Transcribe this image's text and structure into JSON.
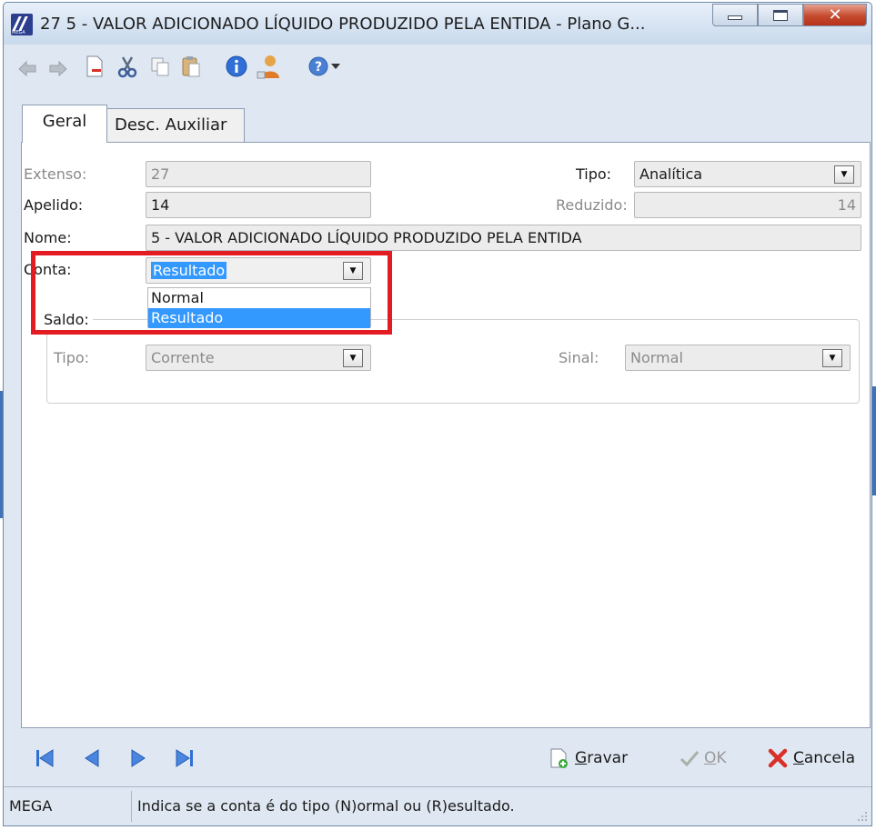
{
  "window": {
    "title": "27 5 - VALOR ADICIONADO LÍQUIDO PRODUZIDO PELA ENTIDA - Plano G...",
    "app_icon_text": "MEGA"
  },
  "toolbar": {
    "icons": [
      "back-icon",
      "forward-icon",
      "new-document-icon",
      "cut-icon",
      "copy-icon",
      "paste-icon",
      "info-icon",
      "users-icon",
      "help-icon",
      "dropdown-arrow-icon"
    ]
  },
  "tabs": [
    {
      "label": "Geral",
      "active": true
    },
    {
      "label": "Desc. Auxiliar",
      "active": false
    }
  ],
  "form": {
    "extenso_label": "Extenso:",
    "extenso_value": "27",
    "tipo_label": "Tipo:",
    "tipo_value": "Analítica",
    "apelido_label": "Apelido:",
    "apelido_value": "14",
    "reduzido_label": "Reduzido:",
    "reduzido_value": "14",
    "nome_label": "Nome:",
    "nome_value": "5 - VALOR ADICIONADO LÍQUIDO PRODUZIDO PELA ENTIDA",
    "conta_label": "Conta:",
    "conta_value": "Resultado",
    "conta_options": [
      "Normal",
      "Resultado"
    ],
    "conta_selected_index": 1,
    "saldo_label": "Saldo:",
    "saldo_tipo_label": "Tipo:",
    "saldo_tipo_value": "Corrente",
    "sinal_label": "Sinal:",
    "sinal_value": "Normal"
  },
  "actions": {
    "gravar_underlined": "G",
    "gravar_rest": "ravar",
    "ok_underlined": "O",
    "ok_rest": "K",
    "cancela_underlined": "C",
    "cancela_rest": "ancela"
  },
  "status": {
    "app": "MEGA",
    "message": "Indica se a conta é do tipo (N)ormal ou (R)esultado."
  },
  "colors": {
    "highlight": "#e31b23",
    "selection": "#3399ff"
  }
}
